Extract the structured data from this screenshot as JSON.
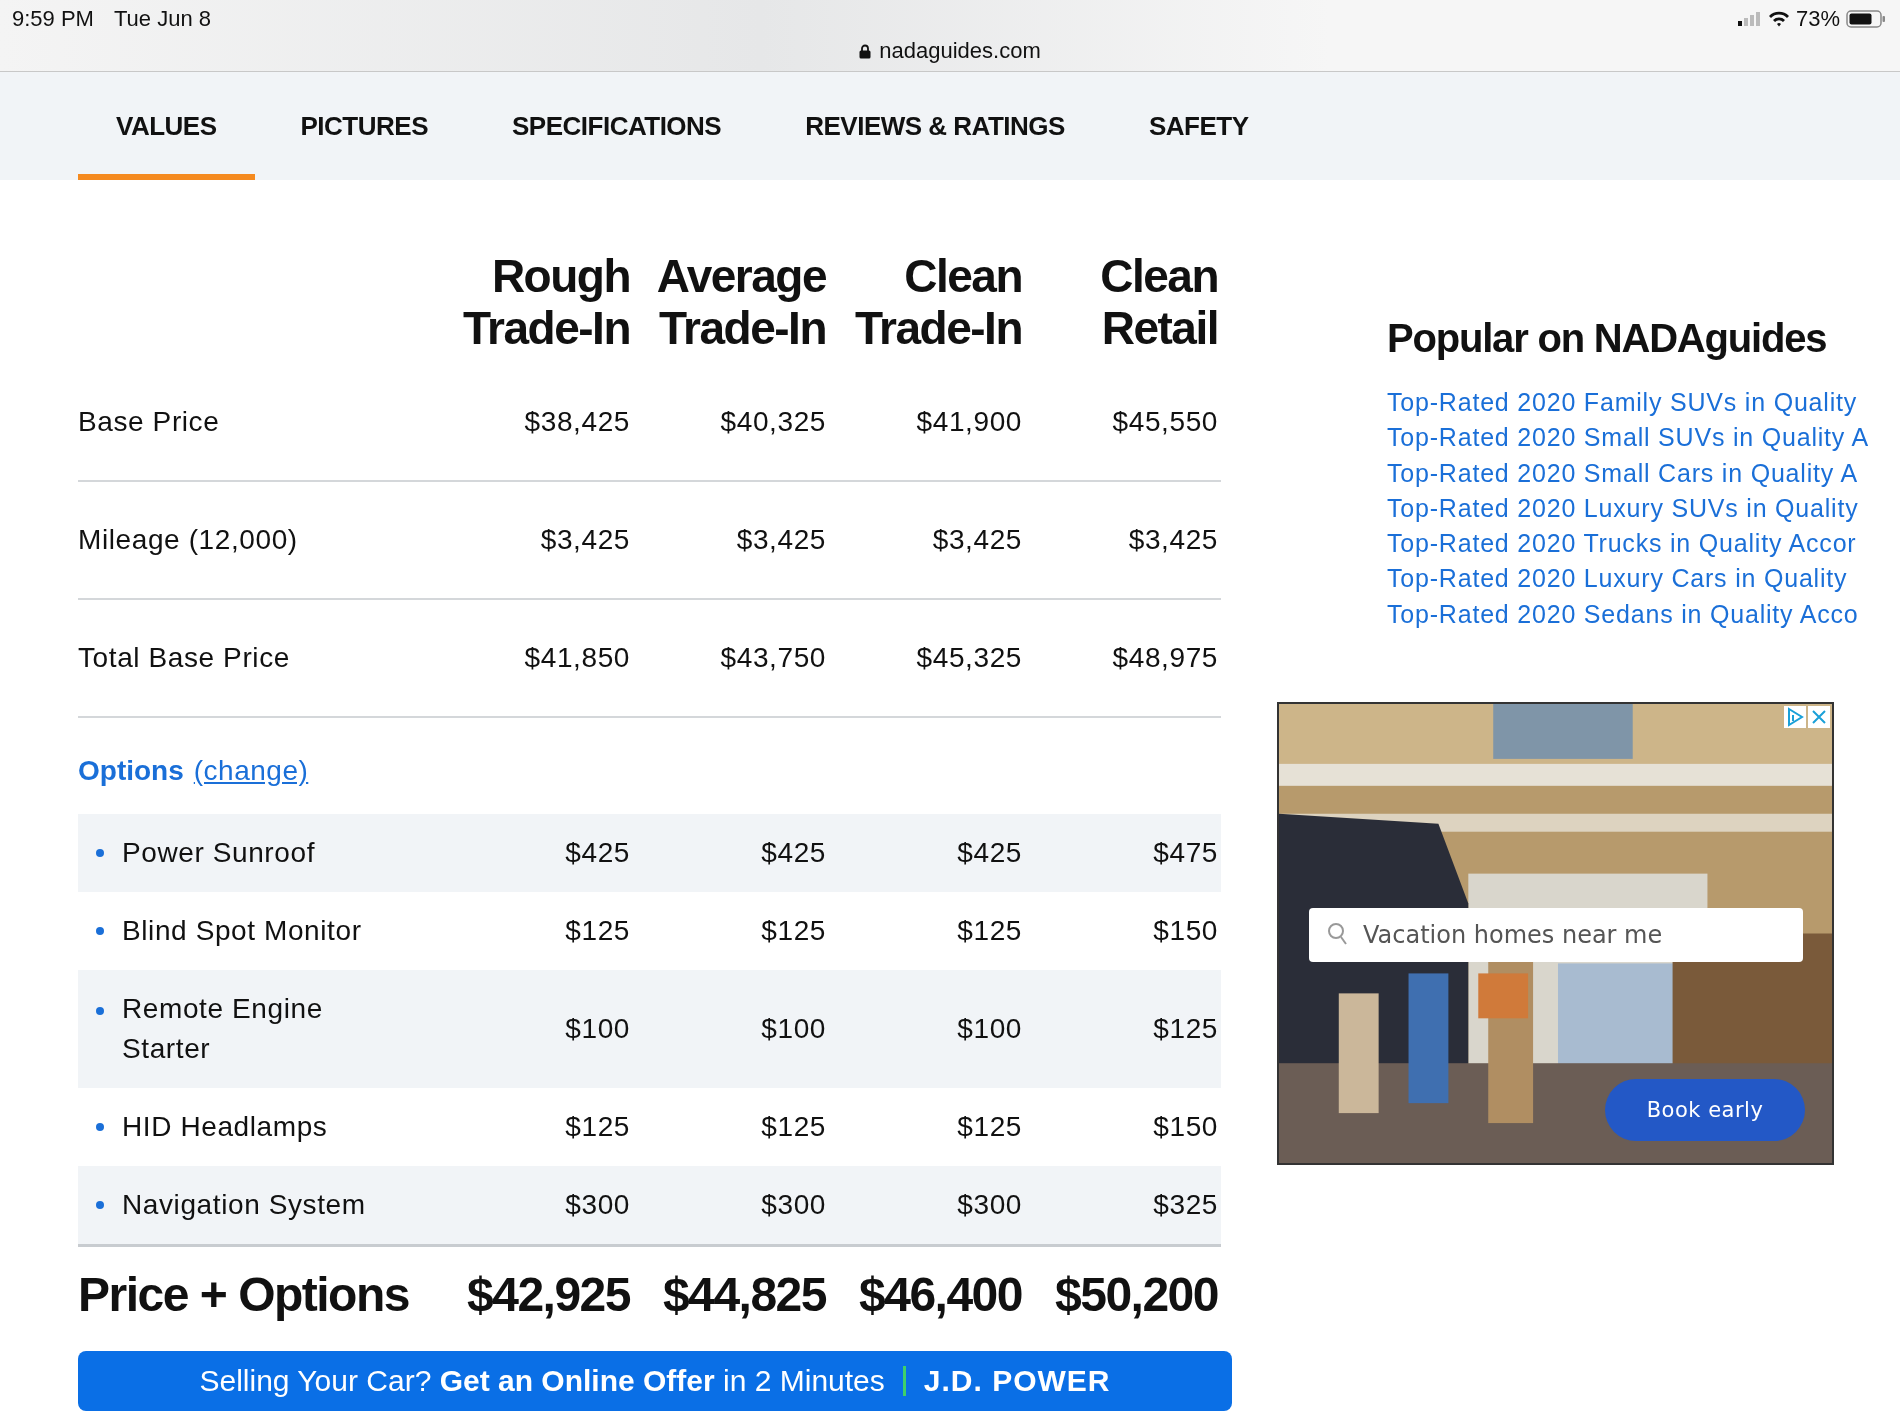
{
  "status_bar": {
    "time": "9:59 PM",
    "date": "Tue Jun 8",
    "url": "nadaguides.com",
    "battery": "73%"
  },
  "tabs": [
    {
      "label": "VALUES",
      "selected": true
    },
    {
      "label": "PICTURES",
      "selected": false
    },
    {
      "label": "SPECIFICATIONS",
      "selected": false
    },
    {
      "label": "REVIEWS & RATINGS",
      "selected": false
    },
    {
      "label": "SAFETY",
      "selected": false
    }
  ],
  "table": {
    "columns": [
      [
        "Rough",
        "Trade-In"
      ],
      [
        "Average",
        "Trade-In"
      ],
      [
        "Clean",
        "Trade-In"
      ],
      [
        "Clean",
        "Retail"
      ]
    ],
    "rows": [
      {
        "label": "Base Price",
        "values": [
          "$38,425",
          "$40,325",
          "$41,900",
          "$45,550"
        ]
      },
      {
        "label": "Mileage (12,000)",
        "values": [
          "$3,425",
          "$3,425",
          "$3,425",
          "$3,425"
        ]
      },
      {
        "label": "Total Base Price",
        "values": [
          "$41,850",
          "$43,750",
          "$45,325",
          "$48,975"
        ]
      }
    ],
    "options_title": "Options",
    "options_link": "(change)",
    "options": [
      {
        "label": "Power Sunroof",
        "values": [
          "$425",
          "$425",
          "$425",
          "$475"
        ]
      },
      {
        "label": "Blind Spot Monitor",
        "values": [
          "$125",
          "$125",
          "$125",
          "$150"
        ]
      },
      {
        "label": "Remote Engine Starter",
        "values": [
          "$100",
          "$100",
          "$100",
          "$125"
        ]
      },
      {
        "label": "HID Headlamps",
        "values": [
          "$125",
          "$125",
          "$125",
          "$150"
        ]
      },
      {
        "label": "Navigation System",
        "values": [
          "$300",
          "$300",
          "$300",
          "$325"
        ]
      }
    ],
    "total": {
      "label": "Price + Options",
      "values": [
        "$42,925",
        "$44,825",
        "$46,400",
        "$50,200"
      ]
    }
  },
  "popular": {
    "title": "Popular on NADAguides",
    "links": [
      "Top-Rated 2020 Family SUVs in Quality",
      "Top-Rated 2020 Small SUVs in Quality A",
      "Top-Rated 2020 Small Cars in Quality A",
      "Top-Rated 2020 Luxury SUVs in Quality",
      "Top-Rated 2020 Trucks in Quality Accor",
      "Top-Rated 2020 Luxury Cars in Quality",
      "Top-Rated 2020 Sedans in Quality Acco"
    ]
  },
  "ad": {
    "search": {
      "placeholder": "Vacation homes near me"
    },
    "button": "Book early"
  },
  "banner": {
    "text": "Selling Your Car? **Get an Online Offer** in 2 Minutes",
    "brand": "J.D. POWER"
  }
}
